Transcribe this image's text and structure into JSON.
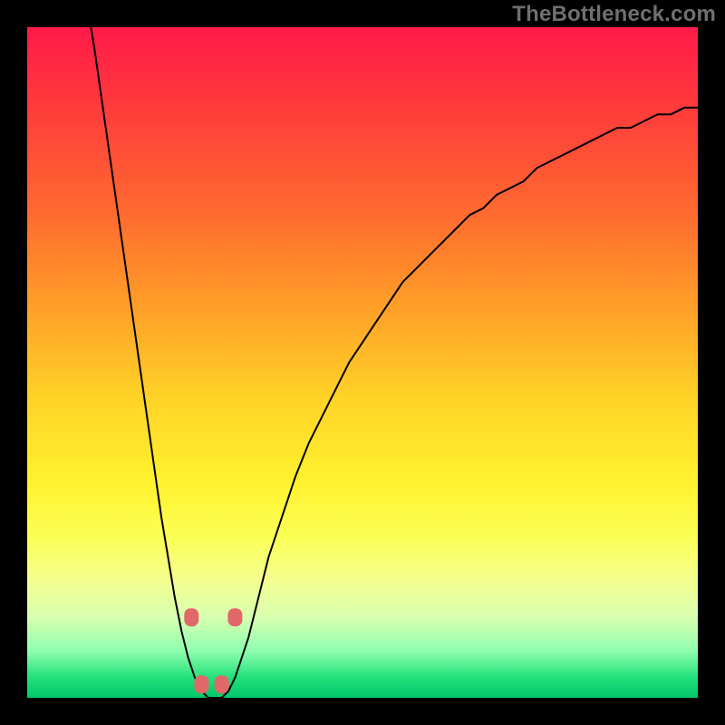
{
  "watermark": "TheBottleneck.com",
  "colors": {
    "background": "#000000",
    "curve": "#000000",
    "marker": "#e06868",
    "gradient_top": "#ff1a4a",
    "gradient_bottom": "#00c86a"
  },
  "chart_data": {
    "type": "line",
    "title": "",
    "xlabel": "",
    "ylabel": "",
    "xlim": [
      0,
      100
    ],
    "ylim": [
      0,
      100
    ],
    "x": [
      9.5,
      10,
      11,
      12,
      13,
      14,
      15,
      16,
      17,
      18,
      19,
      20,
      21,
      22,
      23,
      24,
      25,
      26,
      27,
      28,
      29,
      30,
      31,
      32,
      33,
      34,
      35,
      36,
      38,
      40,
      42,
      44,
      46,
      48,
      50,
      52,
      54,
      56,
      58,
      60,
      62,
      64,
      66,
      68,
      70,
      72,
      74,
      76,
      78,
      80,
      82,
      84,
      86,
      88,
      90,
      92,
      94,
      96,
      98,
      100
    ],
    "values": [
      100,
      97,
      90,
      83,
      76,
      69,
      62,
      55,
      48,
      41,
      34,
      27,
      21,
      15,
      10,
      6,
      3,
      1,
      0,
      0,
      0,
      1,
      3,
      6,
      9,
      13,
      17,
      21,
      27,
      33,
      38,
      42,
      46,
      50,
      53,
      56,
      59,
      62,
      64,
      66,
      68,
      70,
      72,
      73,
      75,
      76,
      77,
      79,
      80,
      81,
      82,
      83,
      84,
      85,
      85,
      86,
      87,
      87,
      88,
      88
    ],
    "markers": [
      {
        "x": 24.5,
        "y": 12
      },
      {
        "x": 26.0,
        "y": 2
      },
      {
        "x": 29.0,
        "y": 2
      },
      {
        "x": 31.0,
        "y": 12
      }
    ],
    "marker_radius_px": 8,
    "grid": false,
    "legend": false
  }
}
